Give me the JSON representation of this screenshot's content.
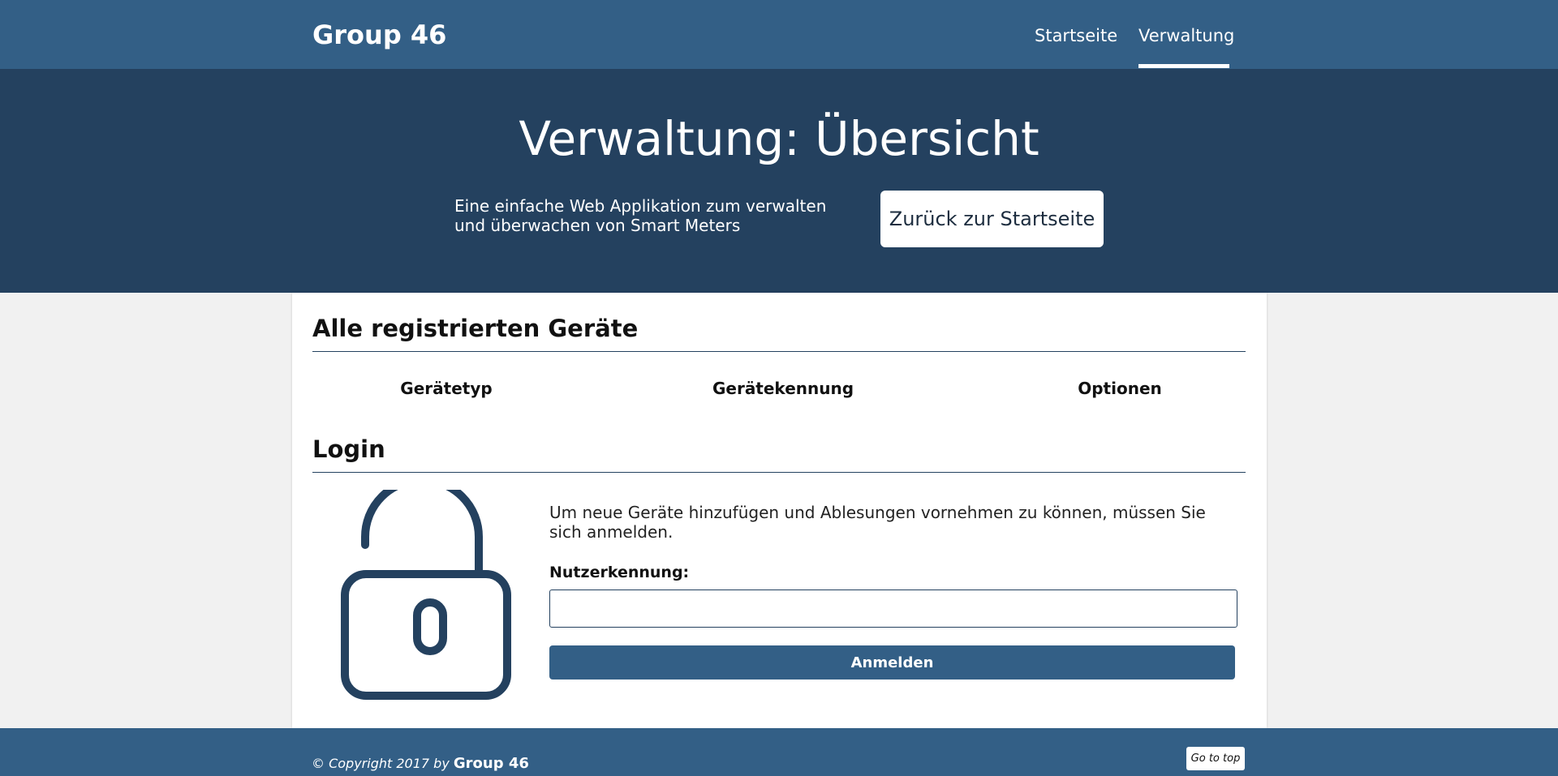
{
  "navbar": {
    "brand": "Group 46",
    "links": [
      {
        "label": "Startseite"
      },
      {
        "label": "Verwaltung"
      }
    ]
  },
  "hero": {
    "title": "Verwaltung: Übersicht",
    "description": "Eine einfache Web Applikation zum verwalten und überwachen von Smart Meters",
    "back_button": "Zurück zur Startseite"
  },
  "devices": {
    "title": "Alle registrierten Geräte",
    "columns": [
      "Gerätetyp",
      "Gerätekennung",
      "Optionen"
    ]
  },
  "login": {
    "title": "Login",
    "description": "Um neue Geräte hinzufügen und Ablesungen vornehmen zu können, müssen Sie sich anmelden.",
    "username_label": "Nutzerkennung:",
    "username_value": "",
    "submit_label": "Anmelden",
    "icon": "unlock-icon"
  },
  "footer": {
    "copyright_prefix": "© Copyright 2017 by",
    "copyright_brand": "Group 46",
    "go_top_label": "Go to top"
  },
  "colors": {
    "navbar": "#335f86",
    "hero": "#24415f",
    "background": "#f1f1f1",
    "accent": "#24415f"
  }
}
